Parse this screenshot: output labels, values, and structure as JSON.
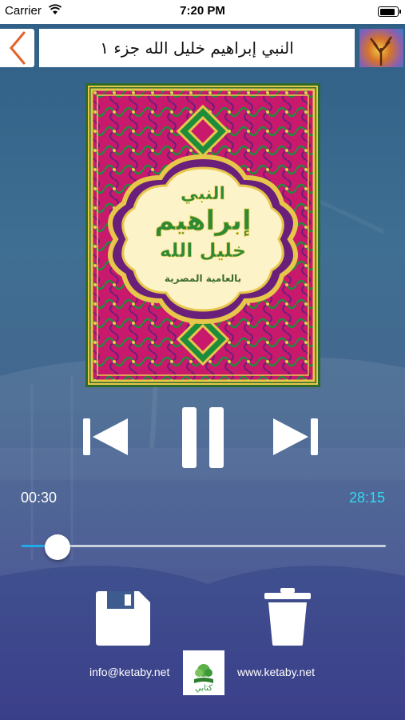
{
  "status_bar": {
    "carrier": "Carrier",
    "time": "7:20 PM"
  },
  "header": {
    "title": "النبي إبراهيم خليل الله جزء ١"
  },
  "cover": {
    "line1": "النبي",
    "line2": "إبراهيم",
    "line3": "خليل الله",
    "line4": "بالعامية المصرية"
  },
  "player": {
    "current_time": "00:30",
    "total_time": "28:15",
    "progress": 0.05
  },
  "footer": {
    "email": "info@ketaby.net",
    "website": "www.ketaby.net",
    "logo_text": "كتابي"
  },
  "colors": {
    "accent": "#33d8ef",
    "back_arrow": "#e2632b",
    "slider_fill": "#1ea9e8"
  },
  "icons": [
    "back-arrow-icon",
    "wifi-icon",
    "battery-icon",
    "previous-icon",
    "pause-icon",
    "next-icon",
    "save-icon",
    "trash-icon"
  ]
}
